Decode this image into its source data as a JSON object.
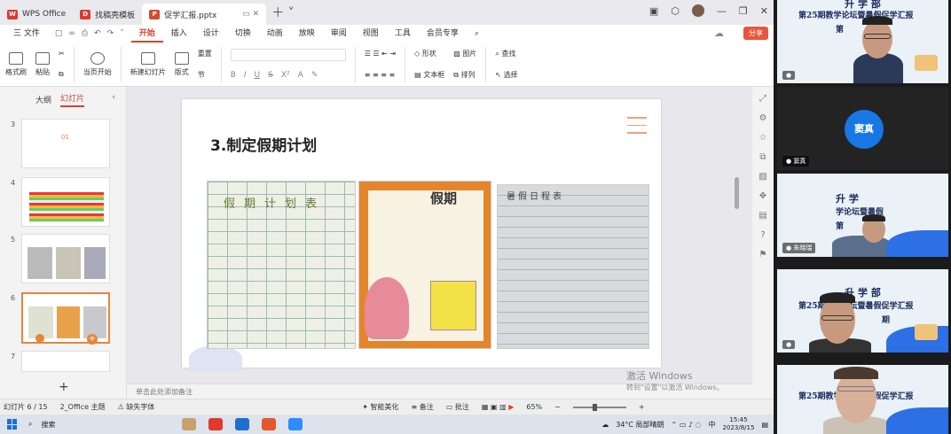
{
  "tabs": [
    {
      "label": "WPS Office"
    },
    {
      "label": "找稿壳模板"
    },
    {
      "label": "促学汇报.pptx"
    }
  ],
  "menu": {
    "file": "三 文件",
    "items": [
      "开始",
      "插入",
      "设计",
      "切换",
      "动画",
      "放映",
      "审阅",
      "视图",
      "工具",
      "会员专享"
    ],
    "active": "开始",
    "share": "分享"
  },
  "ribbon": {
    "format_painter": "格式刷",
    "paste": "粘贴",
    "from_current": "当页开始",
    "new_slide": "新建幻灯片",
    "layout": "版式",
    "reset": "重置",
    "section": "节",
    "shape": "形状",
    "image": "图片",
    "find": "查找",
    "textbox": "文本框",
    "arrange": "排列",
    "select": "选择"
  },
  "left_panel": {
    "tab_outline": "大纲",
    "tab_slides": "幻灯片",
    "thumbs": [
      {
        "num": "3",
        "caption": "01"
      },
      {
        "num": "4",
        "caption": ""
      },
      {
        "num": "5",
        "caption": ""
      },
      {
        "num": "6",
        "caption": ""
      },
      {
        "num": "7",
        "caption": ""
      }
    ]
  },
  "slide": {
    "title": "3.制定假期计划",
    "photo1_title": "假期计划表",
    "photo2_title": "假期",
    "photo3_title": "暑假日程表"
  },
  "notes_placeholder": "单击此处添加备注",
  "watermark": {
    "line1": "激活 Windows",
    "line2": "转到\"设置\"以激活 Windows。"
  },
  "status": {
    "slide_counter": "幻灯片 6 / 15",
    "theme": "2_Office 主题",
    "missing_font": "缺失字体",
    "smart_beautify": "智能美化",
    "notes": "备注",
    "comments": "批注",
    "zoom": "65%"
  },
  "taskbar": {
    "search": "搜索",
    "weather": "34°C 局部晴朗",
    "ime": "中",
    "time": "15:45",
    "date": "2023/8/15"
  },
  "video": {
    "tiles": [
      {
        "banner_line1": "升  学  部",
        "banner_line2": "第25期教学论坛暨暑假促学汇报",
        "banner_line3": "第",
        "name": ""
      },
      {
        "initials": "窦真",
        "name": "窦真"
      },
      {
        "banner_line1": "升  学",
        "banner_line2": "学论坛暨暑假",
        "banner_line3": "第",
        "name": "朱晓瑞"
      },
      {
        "banner_line1": "升  学  部",
        "banner_line2": "第25期教学论坛暨暑假促学汇报",
        "banner_line3": "期",
        "name": ""
      },
      {
        "banner_line1": "",
        "banner_line2": "第25期教学论坛暨暑假促学汇报",
        "banner_line3": "",
        "name": ""
      }
    ]
  }
}
